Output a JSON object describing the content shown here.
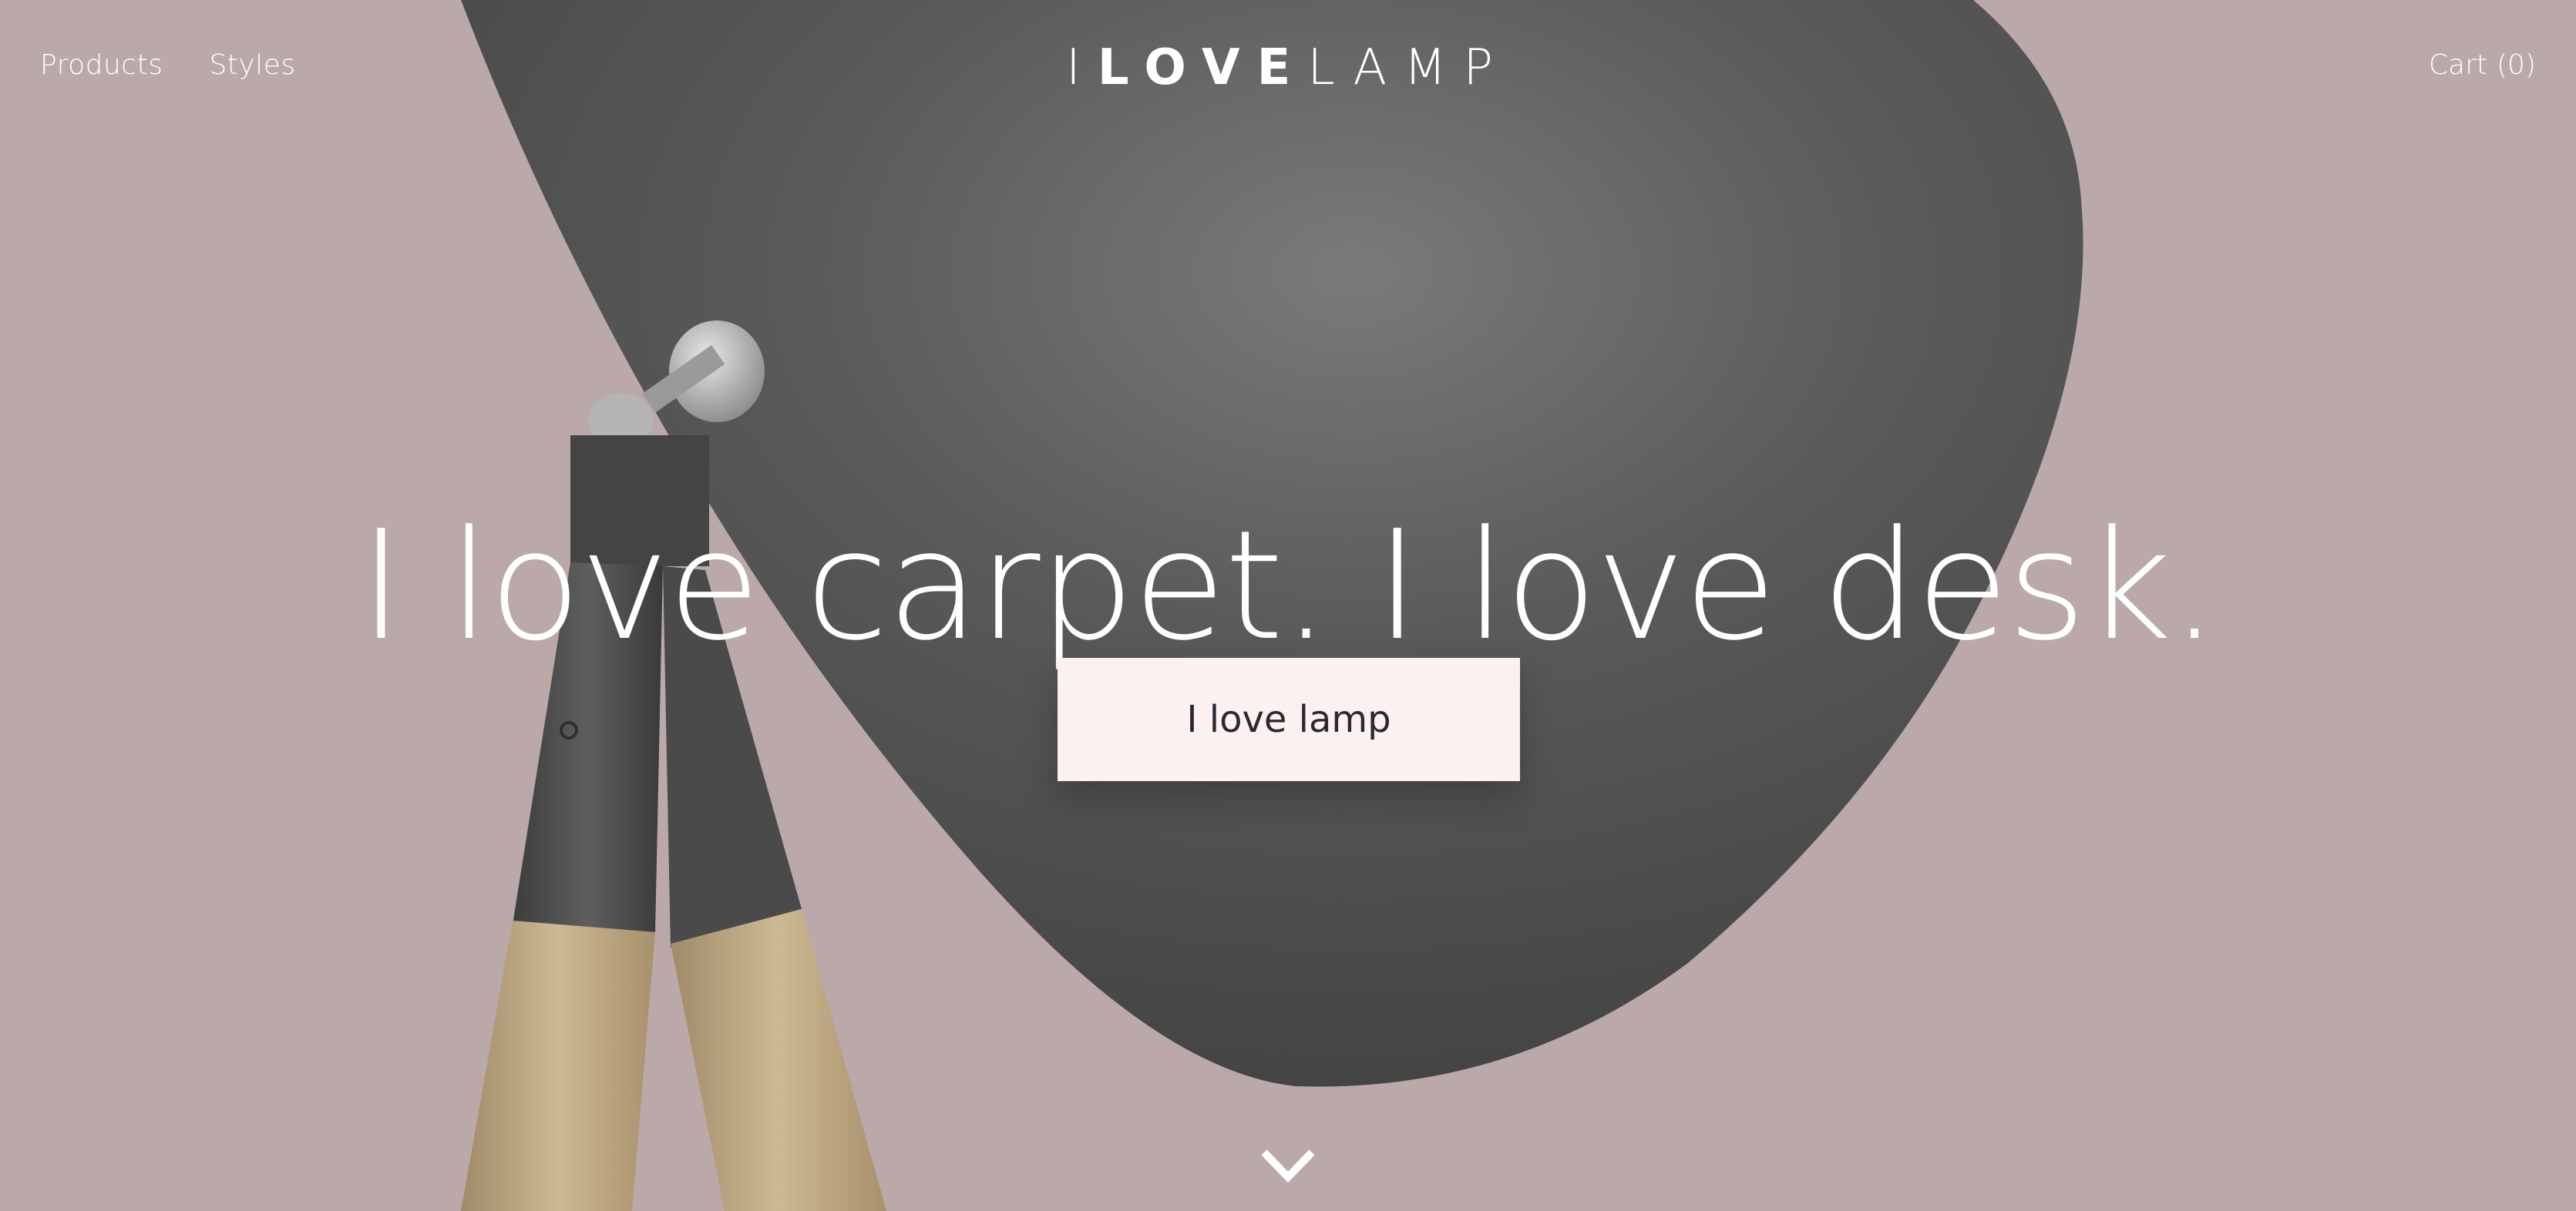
{
  "nav": {
    "products": "Products",
    "styles": "Styles"
  },
  "logo": {
    "part1": "I",
    "part2": "LOVE",
    "part3": "LAMP"
  },
  "cart": {
    "label": "Cart",
    "count": "(0)"
  },
  "hero": {
    "headline": "I love carpet. I love desk.",
    "cta_label": "I love lamp"
  },
  "icons": {
    "scroll": "chevron-down-icon"
  },
  "colors": {
    "background": "#bba9a9",
    "cta_background": "#fcf0f0",
    "cta_text": "#2b2930",
    "text_light": "#ffffff"
  }
}
